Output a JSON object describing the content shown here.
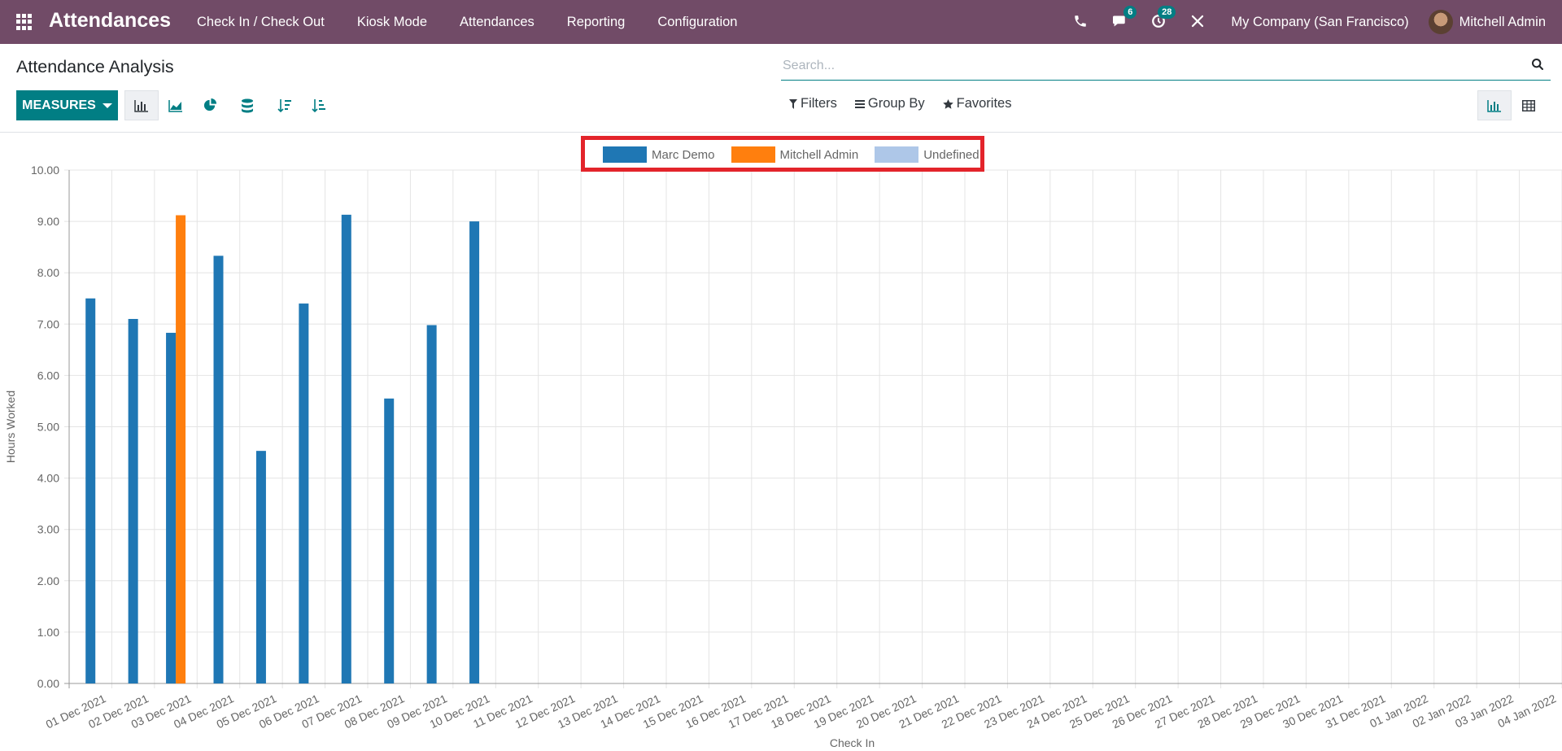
{
  "navbar": {
    "app_name": "Attendances",
    "menu": [
      "Check In / Check Out",
      "Kiosk Mode",
      "Attendances",
      "Reporting",
      "Configuration"
    ],
    "messages_count": "6",
    "activities_count": "28",
    "company": "My Company (San Francisco)",
    "user": "Mitchell Admin",
    "color": "#714B67"
  },
  "control_panel": {
    "title": "Attendance Analysis",
    "search_placeholder": "Search...",
    "measures_label": "MEASURES",
    "filters_label": "Filters",
    "group_by_label": "Group By",
    "favorites_label": "Favorites",
    "accent": "#017e84",
    "tools": [
      "bar-chart-icon",
      "line-chart-icon",
      "pie-chart-icon",
      "stacked-icon",
      "sort-descending-icon",
      "sort-ascending-icon"
    ],
    "views": [
      "graph-view-icon",
      "pivot-view-icon"
    ]
  },
  "chart_data": {
    "type": "bar",
    "xlabel": "Check In",
    "ylabel": "Hours Worked",
    "ylim": [
      0,
      10
    ],
    "yticks": [
      "0.00",
      "1.00",
      "2.00",
      "3.00",
      "4.00",
      "5.00",
      "6.00",
      "7.00",
      "8.00",
      "9.00",
      "10.00"
    ],
    "grid": true,
    "legend_position": "top-center",
    "categories": [
      "01 Dec 2021",
      "02 Dec 2021",
      "03 Dec 2021",
      "04 Dec 2021",
      "05 Dec 2021",
      "06 Dec 2021",
      "07 Dec 2021",
      "08 Dec 2021",
      "09 Dec 2021",
      "10 Dec 2021",
      "11 Dec 2021",
      "12 Dec 2021",
      "13 Dec 2021",
      "14 Dec 2021",
      "15 Dec 2021",
      "16 Dec 2021",
      "17 Dec 2021",
      "18 Dec 2021",
      "19 Dec 2021",
      "20 Dec 2021",
      "21 Dec 2021",
      "22 Dec 2021",
      "23 Dec 2021",
      "24 Dec 2021",
      "25 Dec 2021",
      "26 Dec 2021",
      "27 Dec 2021",
      "28 Dec 2021",
      "29 Dec 2021",
      "30 Dec 2021",
      "31 Dec 2021",
      "01 Jan 2022",
      "02 Jan 2022",
      "03 Jan 2022",
      "04 Jan 2022"
    ],
    "series": [
      {
        "name": "Marc Demo",
        "color": "#1f77b4",
        "values": [
          7.5,
          7.1,
          6.83,
          8.33,
          4.53,
          7.4,
          9.13,
          5.55,
          6.98,
          9.0,
          0,
          0,
          0,
          0,
          0,
          0,
          0,
          0,
          0,
          0,
          0,
          0,
          0,
          0,
          0,
          0,
          0,
          0,
          0,
          0,
          0,
          0,
          0,
          0,
          0
        ]
      },
      {
        "name": "Mitchell Admin",
        "color": "#ff7f0e",
        "values": [
          0,
          0,
          9.12,
          0,
          0,
          0,
          0,
          0,
          0,
          0,
          0,
          0,
          0,
          0,
          0,
          0,
          0,
          0,
          0,
          0,
          0,
          0,
          0,
          0,
          0,
          0,
          0,
          0,
          0,
          0,
          0,
          0,
          0,
          0,
          0
        ]
      },
      {
        "name": "Undefined",
        "color": "#aec7e8",
        "values": [
          0,
          0,
          0,
          0,
          0,
          0,
          0,
          0,
          0,
          0,
          0,
          0,
          0,
          0,
          0,
          0,
          0,
          0,
          0,
          0,
          0,
          0,
          0,
          0,
          0,
          0,
          0,
          0,
          0,
          0,
          0,
          0,
          0,
          0,
          0
        ]
      }
    ]
  }
}
